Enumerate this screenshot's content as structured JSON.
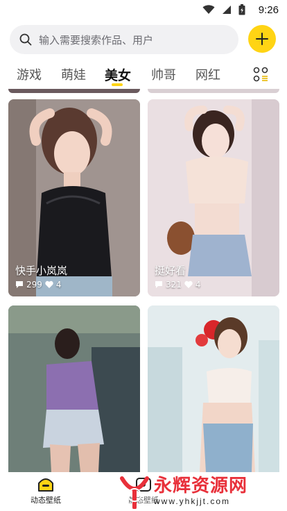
{
  "status": {
    "time": "9:26"
  },
  "search": {
    "placeholder": "输入需要搜索作品、用户"
  },
  "tabs": [
    {
      "label": "游戏"
    },
    {
      "label": "萌娃"
    },
    {
      "label": "美女"
    },
    {
      "label": "帅哥"
    },
    {
      "label": "网红"
    }
  ],
  "cards": [
    {
      "title": "快手小岚岚",
      "comments": "299",
      "likes": "4"
    },
    {
      "title": "挺好看",
      "comments": "321",
      "likes": "4"
    }
  ],
  "bottom_nav": [
    {
      "label": "动态壁纸"
    },
    {
      "label": "静态壁纸"
    }
  ],
  "watermark": {
    "text": "永辉资源网",
    "url": "www.yhkjjt.com"
  },
  "colors": {
    "accent": "#ffd414"
  }
}
